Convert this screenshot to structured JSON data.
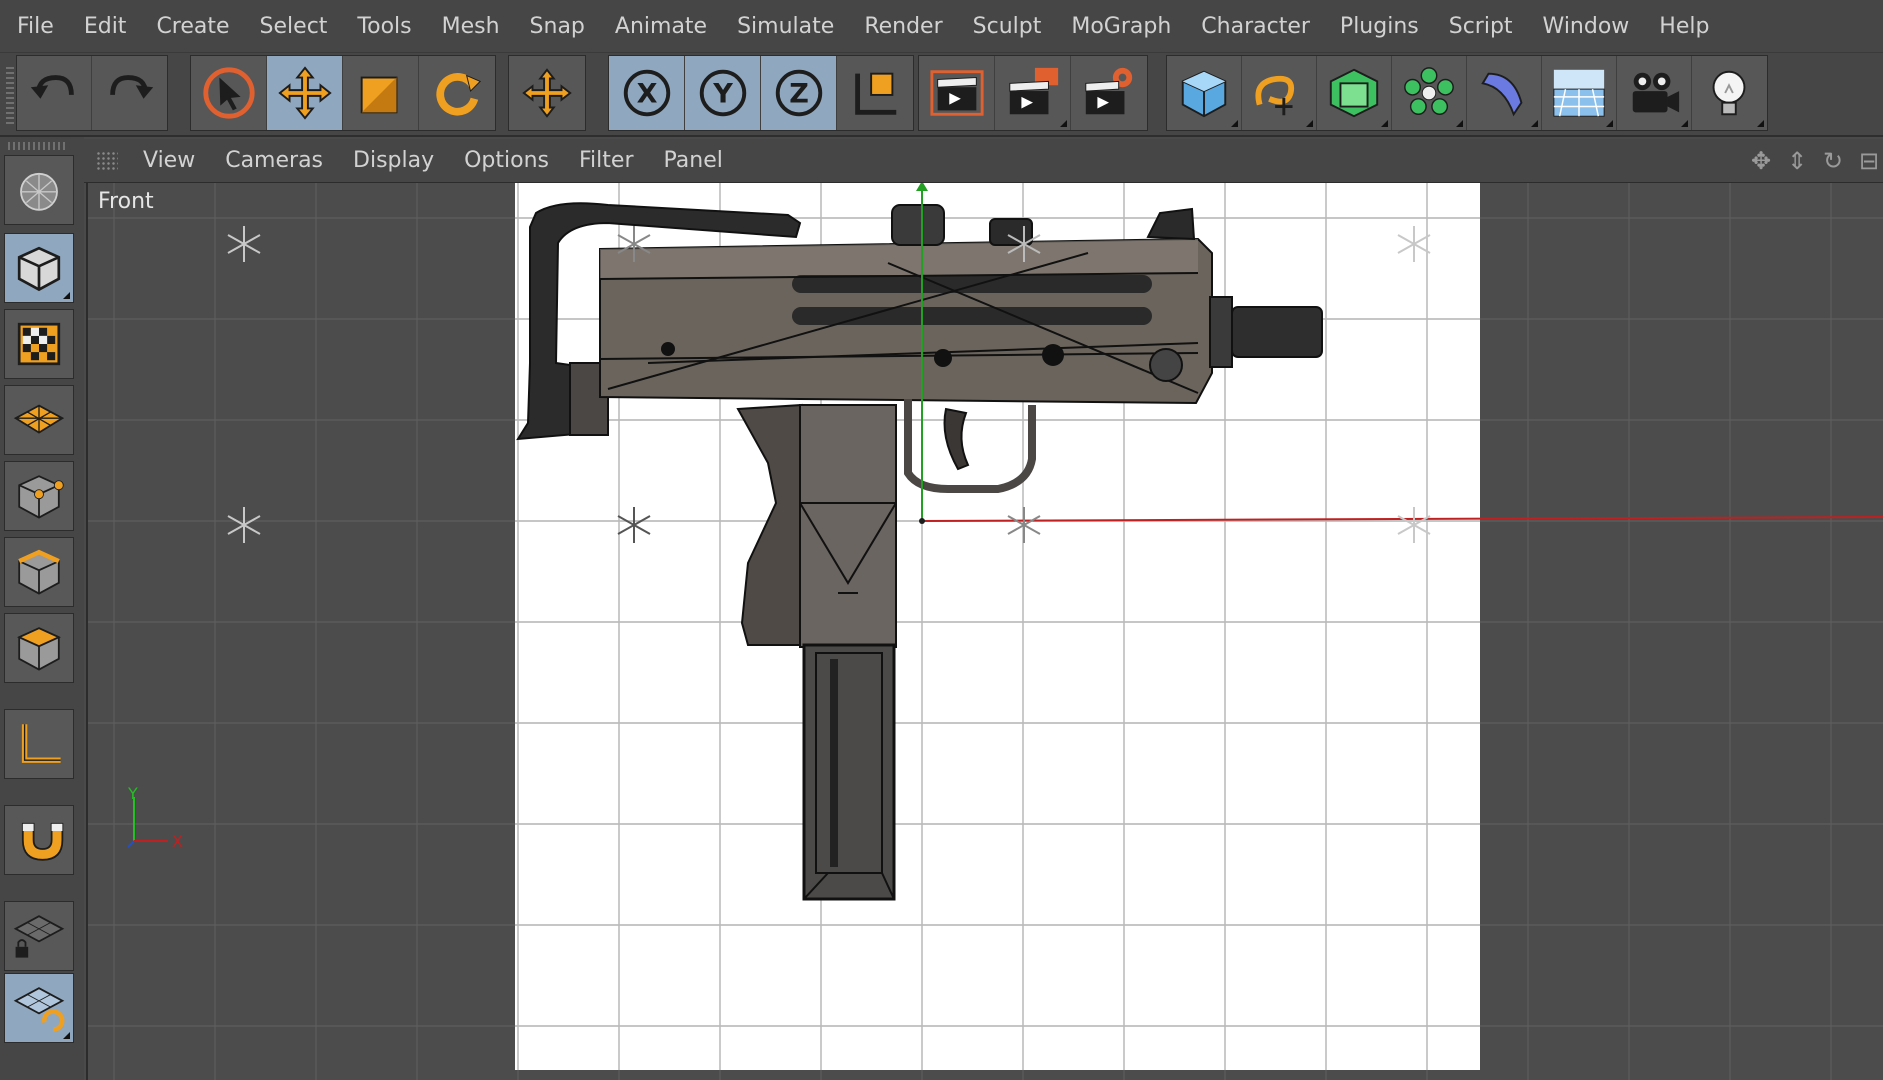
{
  "menubar": {
    "items": [
      "File",
      "Edit",
      "Create",
      "Select",
      "Tools",
      "Mesh",
      "Snap",
      "Animate",
      "Simulate",
      "Render",
      "Sculpt",
      "MoGraph",
      "Character",
      "Plugins",
      "Script",
      "Window",
      "Help"
    ]
  },
  "toolbar": {
    "undo_redo": [
      {
        "name": "undo-icon"
      },
      {
        "name": "redo-icon"
      }
    ],
    "transform_tools": [
      {
        "name": "live-selection-icon",
        "active": false
      },
      {
        "name": "move-icon",
        "active": true
      },
      {
        "name": "scale-icon",
        "active": false
      },
      {
        "name": "rotate-icon",
        "active": false
      },
      {
        "name": "recent-tool-move-icon",
        "active": false
      }
    ],
    "axis_locks": [
      {
        "name": "x-axis-icon",
        "label": "X",
        "active": true
      },
      {
        "name": "y-axis-icon",
        "label": "Y",
        "active": true
      },
      {
        "name": "z-axis-icon",
        "label": "Z",
        "active": true
      },
      {
        "name": "coordinate-system-icon",
        "label": "",
        "active": false
      }
    ],
    "render_tools": [
      {
        "name": "render-view-icon"
      },
      {
        "name": "render-to-picture-viewer-icon"
      },
      {
        "name": "render-settings-icon"
      }
    ],
    "create_tools": [
      {
        "name": "cube-object-icon"
      },
      {
        "name": "spline-pen-icon"
      },
      {
        "name": "subdivision-surface-icon"
      },
      {
        "name": "cloner-icon"
      },
      {
        "name": "deformer-bend-icon"
      },
      {
        "name": "floor-scene-icon"
      },
      {
        "name": "camera-icon"
      },
      {
        "name": "light-icon"
      }
    ]
  },
  "leftbar": {
    "tools": [
      {
        "name": "make-editable-icon",
        "active": false
      },
      {
        "name": "model-mode-icon",
        "active": true
      },
      {
        "name": "texture-mode-icon",
        "active": false
      },
      {
        "name": "workplane-mode-icon",
        "active": false
      },
      {
        "name": "points-mode-icon",
        "active": false
      },
      {
        "name": "edges-mode-icon",
        "active": false
      },
      {
        "name": "polygons-mode-icon",
        "active": false
      },
      {
        "name": "enable-axis-icon",
        "active": false
      },
      {
        "name": "snapping-icon",
        "active": false
      },
      {
        "name": "workplane-lock-icon",
        "active": false
      },
      {
        "name": "planar-workplane-icon",
        "active": true
      }
    ]
  },
  "viewport": {
    "menu": [
      "View",
      "Cameras",
      "Display",
      "Options",
      "Filter",
      "Panel"
    ],
    "nav_icons": [
      "move-view-icon",
      "zoom-view-icon",
      "rotate-view-icon",
      "toggle-layout-icon"
    ],
    "view_label": "Front",
    "axis_gizmo": {
      "y_label": "Y",
      "x_label": "X"
    },
    "colors": {
      "grid": "#5e5e5e",
      "axis_x": "#c02020",
      "axis_y": "#20a020",
      "selection": "#8fa7bf",
      "accent_orange": "#f0a020"
    }
  }
}
